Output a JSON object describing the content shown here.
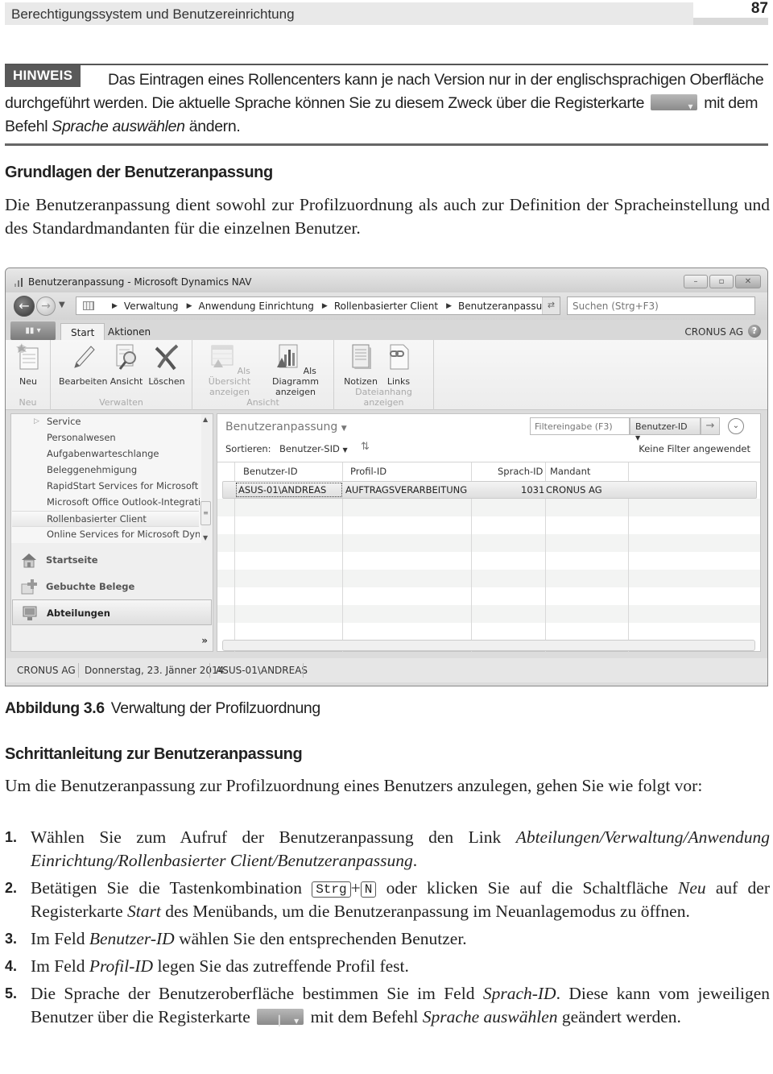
{
  "running_header": {
    "title": "Berechtigungssystem und Benutzereinrichtung",
    "page_number": "87"
  },
  "note": {
    "label": "HINWEIS",
    "text_1": "Das Eintragen eines Rollencenters kann je nach Version nur in der englischsprachigen Oberfläche durchgeführt werden. Die aktuelle Sprache können Sie zu diesem Zweck über die Registerkarte",
    "text_2": "mit dem Befehl",
    "text_italic": "Sprache auswählen",
    "text_3": "ändern."
  },
  "section1": {
    "heading": "Grundlagen der Benutzeranpassung",
    "paragraph": "Die Benutzeranpassung dient sowohl zur Profilzuordnung als auch zur Definition der Spracheinstellung und des Standardmandanten für die einzelnen Benutzer."
  },
  "window": {
    "title": "Benutzeranpassung - Microsoft Dynamics NAV",
    "controls": {
      "minimize": "–",
      "maximize": "▫",
      "close": "✕"
    },
    "breadcrumb": [
      "Verwaltung",
      "Anwendung Einrichtung",
      "Rollenbasierter Client",
      "Benutzeranpassung"
    ],
    "search_placeholder": "Suchen (Strg+F3)",
    "ribbon_tabs": [
      "Start",
      "Aktionen"
    ],
    "company": "CRONUS AG",
    "ribbon_groups": [
      {
        "label": "Neu",
        "buttons": [
          {
            "label": "Neu",
            "icon": "new-document-icon",
            "disabled": false
          }
        ]
      },
      {
        "label": "Verwalten",
        "buttons": [
          {
            "label": "Bearbeiten",
            "icon": "pencil-icon",
            "disabled": false
          },
          {
            "label": "Ansicht",
            "icon": "view-magnifier-icon",
            "disabled": false
          },
          {
            "label": "Löschen",
            "icon": "delete-x-icon",
            "disabled": false
          }
        ]
      },
      {
        "label": "Ansicht",
        "buttons": [
          {
            "label": "Als Übersicht anzeigen",
            "line1": "Als Übersicht",
            "line2": "anzeigen",
            "icon": "list-view-icon",
            "disabled": true
          },
          {
            "label": "Als Diagramm anzeigen",
            "line1": "Als Diagramm",
            "line2": "anzeigen",
            "icon": "chart-view-icon",
            "disabled": false
          }
        ]
      },
      {
        "label": "Dateianhang anzeigen",
        "buttons": [
          {
            "label": "Notizen",
            "icon": "notes-icon",
            "disabled": false
          },
          {
            "label": "Links",
            "icon": "links-icon",
            "disabled": false
          }
        ]
      }
    ],
    "nav_tree": [
      {
        "label": "Service",
        "expandable": true
      },
      {
        "label": "Personalwesen"
      },
      {
        "label": "Aufgabenwarteschlange"
      },
      {
        "label": "Beleggenehmigung"
      },
      {
        "label": "RapidStart Services for Microsoft Dynamics NAV"
      },
      {
        "label": "Microsoft Office Outlook-Integration"
      },
      {
        "label": "Rollenbasierter Client",
        "selected": true
      },
      {
        "label": "Online Services for Microsoft Dynamics NAV"
      }
    ],
    "nav_buttons": [
      {
        "label": "Startseite",
        "icon": "home-icon"
      },
      {
        "label": "Gebuchte Belege",
        "icon": "posted-documents-icon"
      },
      {
        "label": "Abteilungen",
        "icon": "departments-icon",
        "active": true
      }
    ],
    "page": {
      "title": "Benutzeranpassung",
      "filter_placeholder": "Filtereingabe (F3)",
      "filter_field": "Benutzer-ID",
      "sort_label": "Sortieren:",
      "sort_field": "Benutzer-SID",
      "filter_status": "Keine Filter angewendet",
      "columns": [
        "Benutzer-ID",
        "Profil-ID",
        "Sprach-ID",
        "Mandant"
      ],
      "rows": [
        {
          "benutzer_id": "ASUS-01\\ANDREAS",
          "profil_id": "AUFTRAGSVERARBEITUNG",
          "sprach_id": "1031",
          "mandant": "CRONUS AG"
        }
      ]
    },
    "status_bar": [
      "CRONUS AG",
      "Donnerstag, 23. Jänner 2014",
      "ASUS-01\\ANDREAS"
    ]
  },
  "caption": {
    "label": "Abbildung 3.6",
    "text": "Verwaltung der Profilzuordnung"
  },
  "section2": {
    "heading": "Schrittanleitung zur Benutzeranpassung",
    "intro": "Um die Benutzeranpassung zur Profilzuordnung eines Benutzers anzulegen, gehen Sie wie folgt vor:",
    "steps": [
      {
        "num": "1.",
        "a": "Wählen Sie zum Aufruf der Benutzeranpassung den Link ",
        "i": "Abteilungen/Verwaltung/Anwendung Einrichtung/Rollenbasierter Client/Benutzeranpassung",
        "b": "."
      },
      {
        "num": "2.",
        "a": "Betätigen Sie die Tastenkombination ",
        "key1": "Strg",
        "plus": "+",
        "key2": "N",
        "b": " oder klicken Sie auf die Schaltfläche ",
        "i1": "Neu",
        "c": " auf der Registerkarte ",
        "i2": "Start",
        "d": " des Menübands, um die Benutzeranpassung im Neuanlagemodus zu öffnen."
      },
      {
        "num": "3.",
        "a": "Im Feld ",
        "i": "Benutzer-ID",
        "b": " wählen Sie den entsprechenden Benutzer."
      },
      {
        "num": "4.",
        "a": "Im Feld ",
        "i": "Profil-ID",
        "b": " legen Sie das zutreffende Profil fest."
      },
      {
        "num": "5.",
        "a": "Die Sprache der Benutzeroberfläche bestimmen Sie im Feld ",
        "i1": "Sprach-ID",
        "b": ". Diese kann vom jeweiligen Benutzer über die Registerkarte ",
        "c": " mit dem Befehl ",
        "i2": "Sprache auswählen",
        "d": " geändert werden."
      }
    ]
  }
}
